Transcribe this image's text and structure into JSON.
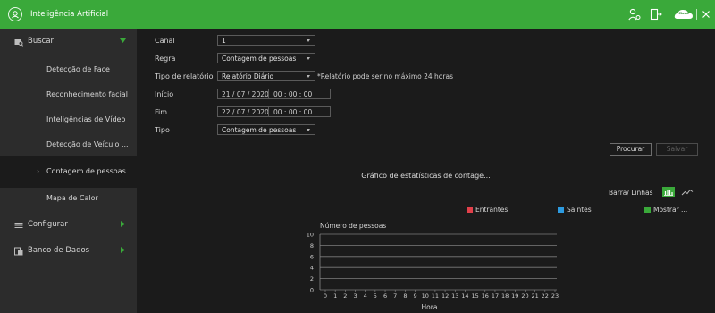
{
  "titlebar": {
    "title": "Inteligência Artificial",
    "logo_icon": "ai-face-icon",
    "cloud_label": "Cloud",
    "accent": "#3aa93a"
  },
  "sidebar": {
    "groups": [
      {
        "label": "Buscar",
        "icon": "search-folder-icon",
        "expanded": true
      },
      {
        "label": "Configurar",
        "icon": "list-icon",
        "expanded": false
      },
      {
        "label": "Banco de Dados",
        "icon": "database-icon",
        "expanded": false
      }
    ],
    "items": [
      {
        "label": "Detecção de Face"
      },
      {
        "label": "Reconhecimento facial"
      },
      {
        "label": "Inteligências de Vídeo"
      },
      {
        "label": "Detecção de Veículo ..."
      },
      {
        "label": "Contagem de pessoas",
        "active": true
      },
      {
        "label": "Mapa de Calor"
      }
    ]
  },
  "form": {
    "canal_label": "Canal",
    "canal_value": "1",
    "regra_label": "Regra",
    "regra_value": "Contagem de pessoas",
    "tipo_relatorio_label": "Tipo de relatório",
    "tipo_relatorio_value": "Relatório Diário",
    "tipo_relatorio_note": "*Relatório pode ser no máximo 24 horas",
    "inicio_label": "Início",
    "inicio_date": "21 / 07 / 2020",
    "inicio_time": "00 : 00 : 00",
    "fim_label": "Fim",
    "fim_date": "22 / 07 / 2020",
    "fim_time": "00 : 00 : 00",
    "tipo_label": "Tipo",
    "tipo_value": "Contagem de pessoas",
    "procurar_label": "Procurar",
    "salvar_label": "Salvar"
  },
  "chart_panel": {
    "heading": "Gráfico de estatísticas de contage...",
    "barra_linhas_label": "Barra/ Linhas"
  },
  "chart_data": {
    "type": "bar",
    "ylabel": "Número de pessoas",
    "xlabel": "Hora",
    "ylim": [
      0,
      10
    ],
    "yticks": [
      0,
      2,
      4,
      6,
      8,
      10
    ],
    "categories": [
      "0",
      "1",
      "2",
      "3",
      "4",
      "5",
      "6",
      "7",
      "8",
      "9",
      "10",
      "11",
      "12",
      "13",
      "14",
      "15",
      "16",
      "17",
      "18",
      "19",
      "20",
      "21",
      "22",
      "23"
    ],
    "grid": true,
    "series": [
      {
        "name": "Entrantes",
        "color": "#e2404a",
        "values": [
          0,
          0,
          0,
          0,
          0,
          0,
          0,
          0,
          0,
          0,
          0,
          0,
          0,
          0,
          0,
          0,
          0,
          0,
          0,
          0,
          0,
          0,
          0,
          0
        ]
      },
      {
        "name": "Saintes",
        "color": "#2d9be0",
        "values": [
          0,
          0,
          0,
          0,
          0,
          0,
          0,
          0,
          0,
          0,
          0,
          0,
          0,
          0,
          0,
          0,
          0,
          0,
          0,
          0,
          0,
          0,
          0,
          0
        ]
      },
      {
        "name": "Mostrar ...",
        "color": "#3aa93a",
        "values": [
          0,
          0,
          0,
          0,
          0,
          0,
          0,
          0,
          0,
          0,
          0,
          0,
          0,
          0,
          0,
          0,
          0,
          0,
          0,
          0,
          0,
          0,
          0,
          0
        ]
      }
    ],
    "legend_position": "top-right"
  }
}
